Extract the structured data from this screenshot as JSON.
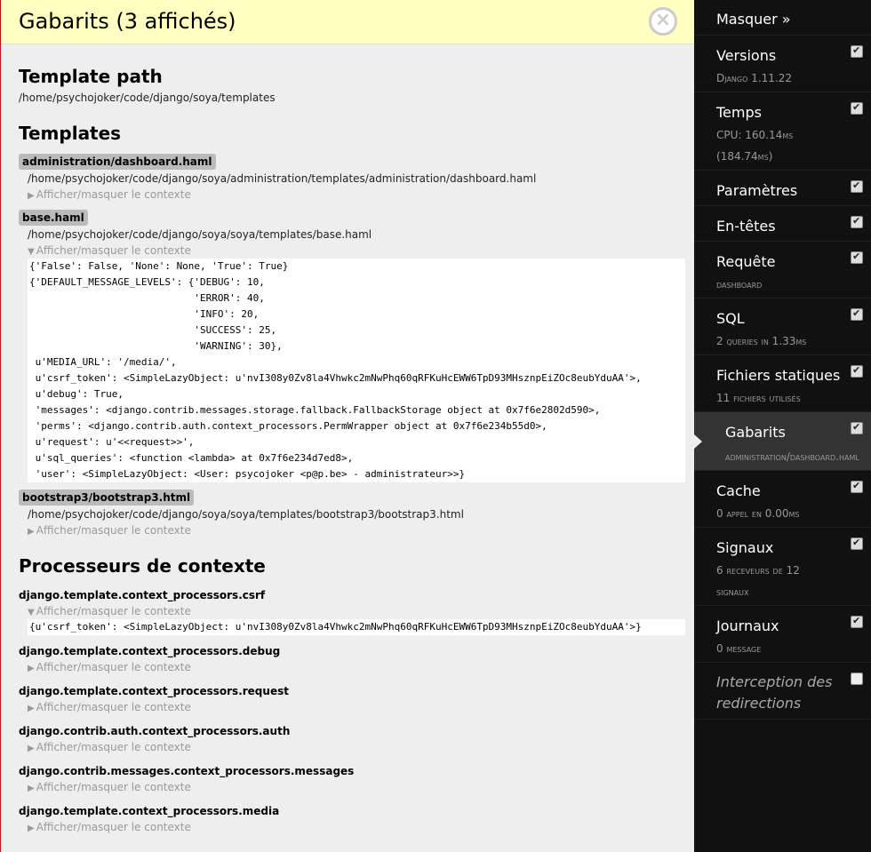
{
  "panel": {
    "title": "Gabarits (3 affichés)",
    "template_path_heading": "Template path",
    "template_path": "/home/psychojoker/code/django/soya/templates",
    "templates_heading": "Templates",
    "toggle_label": "Afficher/masquer le contexte",
    "templates": [
      {
        "name": "administration/dashboard.haml",
        "path": "/home/psychojoker/code/django/soya/administration/templates/administration/dashboard.haml",
        "expanded": false
      },
      {
        "name": "base.haml",
        "path": "/home/psychojoker/code/django/soya/soya/templates/base.haml",
        "expanded": true,
        "context_lines": [
          "{'False': False, 'None': None, 'True': True}",
          "{'DEFAULT_MESSAGE_LEVELS': {'DEBUG': 10,",
          "                            'ERROR': 40,",
          "                            'INFO': 20,",
          "                            'SUCCESS': 25,",
          "                            'WARNING': 30},",
          " u'MEDIA_URL': '/media/',",
          " u'csrf_token': <SimpleLazyObject: u'nvI308y0Zv8la4Vhwkc2mNwPhq60qRFKuHcEWW6TpD93MHsznpEiZOc8eubYduAA'>,",
          " u'debug': True,",
          " 'messages': <django.contrib.messages.storage.fallback.FallbackStorage object at 0x7f6e2802d590>,",
          " 'perms': <django.contrib.auth.context_processors.PermWrapper object at 0x7f6e234b55d0>,",
          " u'request': u'<<request>>',",
          " u'sql_queries': <function <lambda> at 0x7f6e234d7ed8>,",
          " 'user': <SimpleLazyObject: <User: psycojoker <p@p.be> - administrateur>>}"
        ]
      },
      {
        "name": "bootstrap3/bootstrap3.html",
        "path": "/home/psychojoker/code/django/soya/soya/templates/bootstrap3/bootstrap3.html",
        "expanded": false
      }
    ],
    "processors_heading": "Processeurs de contexte",
    "processors": [
      {
        "name": "django.template.context_processors.csrf",
        "expanded": true,
        "context_lines": [
          "{u'csrf_token': <SimpleLazyObject: u'nvI308y0Zv8la4Vhwkc2mNwPhq60qRFKuHcEWW6TpD93MHsznpEiZOc8eubYduAA'>}"
        ]
      },
      {
        "name": "django.template.context_processors.debug",
        "expanded": false
      },
      {
        "name": "django.template.context_processors.request",
        "expanded": false
      },
      {
        "name": "django.contrib.auth.context_processors.auth",
        "expanded": false
      },
      {
        "name": "django.contrib.messages.context_processors.messages",
        "expanded": false
      },
      {
        "name": "django.template.context_processors.media",
        "expanded": false
      }
    ]
  },
  "sidebar": {
    "hide_label": "Masquer »",
    "items": [
      {
        "title": "Versions",
        "subtitle": "Django 1.11.22",
        "checked": true
      },
      {
        "title": "Temps",
        "subtitle": "CPU: 160.14ms",
        "subtitle2": "(184.74ms)",
        "checked": true
      },
      {
        "title": "Paramètres",
        "checked": true
      },
      {
        "title": "En-têtes",
        "checked": true
      },
      {
        "title": "Requête",
        "subtitle": "dashboard",
        "checked": true
      },
      {
        "title": "SQL",
        "subtitle": "2 queries in 1.33ms",
        "checked": true
      },
      {
        "title": "Fichiers statiques",
        "subtitle": "11 fichiers utilisés",
        "checked": true
      },
      {
        "title": "Gabarits",
        "subtitle": "administration/dashboard.haml",
        "checked": true,
        "active": true
      },
      {
        "title": "Cache",
        "subtitle": "0 appel en 0.00ms",
        "checked": true
      },
      {
        "title": "Signaux",
        "subtitle": "6 receveurs de 12",
        "subtitle2": "signaux",
        "checked": true
      },
      {
        "title": "Journaux",
        "subtitle": "0 message",
        "checked": true
      },
      {
        "title": "Interception des redirections",
        "checked": false
      }
    ]
  }
}
